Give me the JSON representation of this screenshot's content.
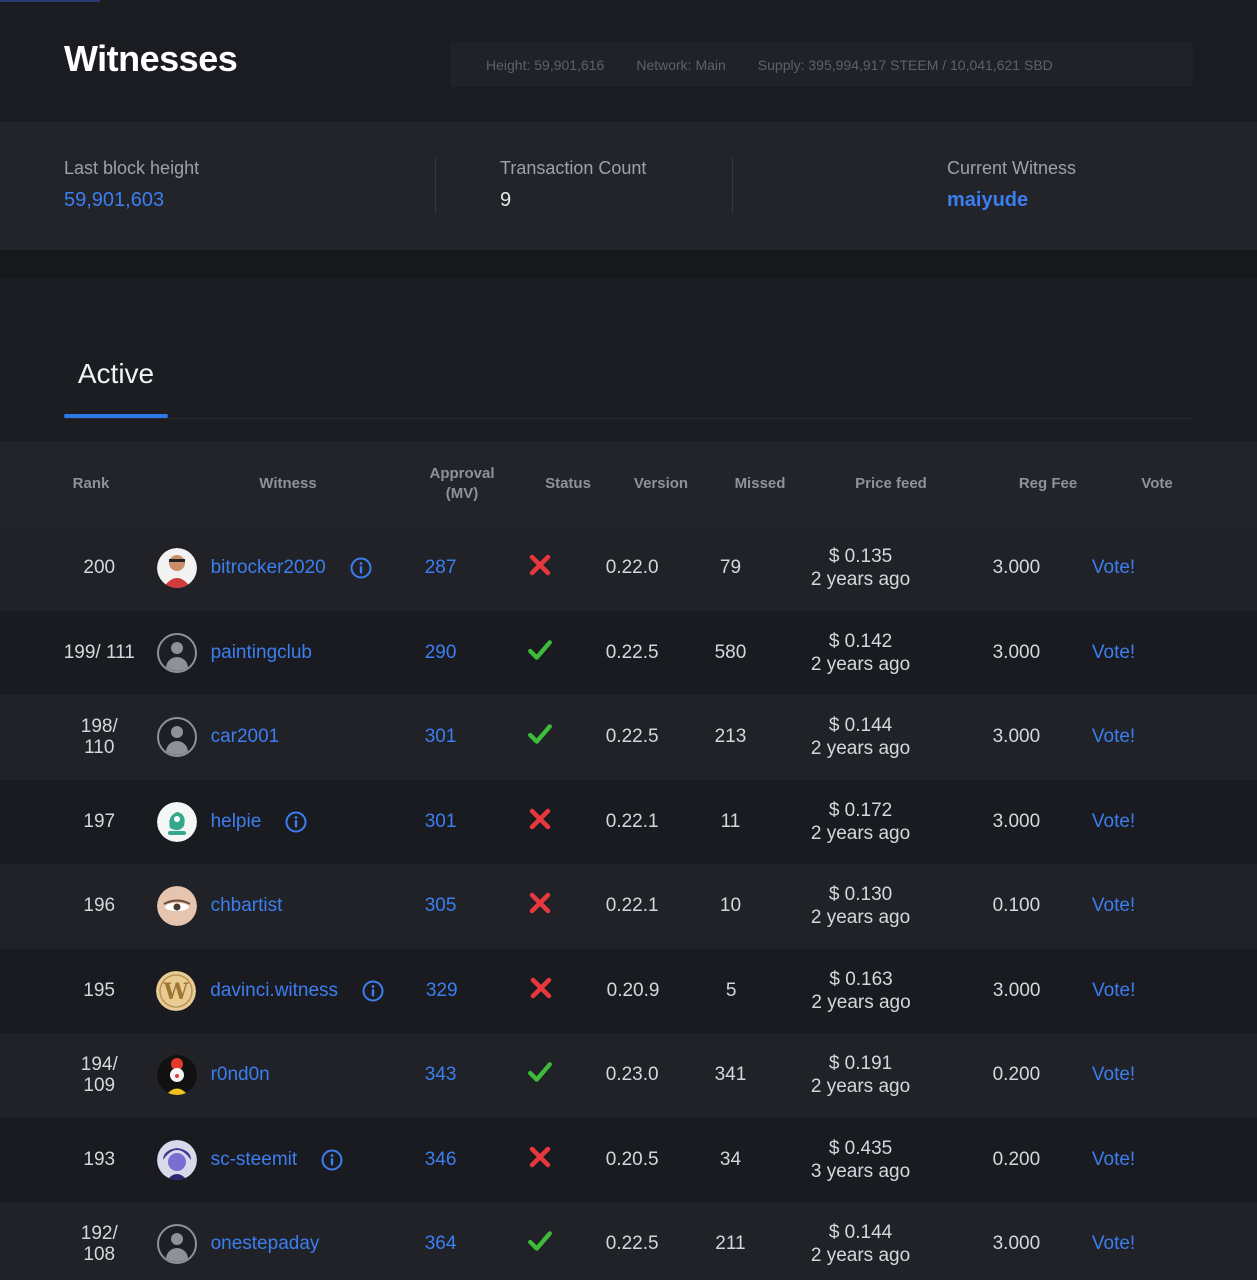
{
  "header": {
    "title": "Witnesses",
    "height": "Height: 59,901,616",
    "network": "Network: Main",
    "supply": "Supply: 395,994,917 STEEM / 10,041,621 SBD"
  },
  "stats": {
    "last_block_label": "Last block height",
    "last_block_value": "59,901,603",
    "tx_count_label": "Transaction Count",
    "tx_count_value": "9",
    "current_witness_label": "Current Witness",
    "current_witness_value": "maiyude"
  },
  "tabs": {
    "active_label": "Active"
  },
  "table": {
    "headers": {
      "rank": "Rank",
      "witness": "Witness",
      "approval_line1": "Approval",
      "approval_line2": "(MV)",
      "status": "Status",
      "version": "Version",
      "missed": "Missed",
      "price_feed": "Price feed",
      "reg_fee": "Reg Fee",
      "vote": "Vote"
    },
    "rows": [
      {
        "rank1": "200",
        "rank2": "",
        "name": "bitrocker2020",
        "avatar": "photo-red",
        "info": true,
        "approval": "287",
        "status": "inactive",
        "version": "0.22.0",
        "missed": "79",
        "price": "$ 0.135",
        "age": "2 years ago",
        "fee": "3.000",
        "vote": "Vote!"
      },
      {
        "rank1": "199/ 111",
        "rank2": "",
        "name": "paintingclub",
        "avatar": "placeholder",
        "info": false,
        "approval": "290",
        "status": "active",
        "version": "0.22.5",
        "missed": "580",
        "price": "$ 0.142",
        "age": "2 years ago",
        "fee": "3.000",
        "vote": "Vote!"
      },
      {
        "rank1": "198/",
        "rank2": "110",
        "name": "car2001",
        "avatar": "placeholder",
        "info": false,
        "approval": "301",
        "status": "active",
        "version": "0.22.5",
        "missed": "213",
        "price": "$ 0.144",
        "age": "2 years ago",
        "fee": "3.000",
        "vote": "Vote!"
      },
      {
        "rank1": "197",
        "rank2": "",
        "name": "helpie",
        "avatar": "photo-teal",
        "info": true,
        "approval": "301",
        "status": "inactive",
        "version": "0.22.1",
        "missed": "11",
        "price": "$ 0.172",
        "age": "2 years ago",
        "fee": "3.000",
        "vote": "Vote!"
      },
      {
        "rank1": "196",
        "rank2": "",
        "name": "chbartist",
        "avatar": "photo-skin",
        "info": false,
        "approval": "305",
        "status": "inactive",
        "version": "0.22.1",
        "missed": "10",
        "price": "$ 0.130",
        "age": "2 years ago",
        "fee": "0.100",
        "vote": "Vote!"
      },
      {
        "rank1": "195",
        "rank2": "",
        "name": "davinci.witness",
        "avatar": "photo-gold",
        "info": true,
        "approval": "329",
        "status": "inactive",
        "version": "0.20.9",
        "missed": "5",
        "price": "$ 0.163",
        "age": "2 years ago",
        "fee": "3.000",
        "vote": "Vote!"
      },
      {
        "rank1": "194/",
        "rank2": "109",
        "name": "r0nd0n",
        "avatar": "photo-clown",
        "info": false,
        "approval": "343",
        "status": "active",
        "version": "0.23.0",
        "missed": "341",
        "price": "$ 0.191",
        "age": "2 years ago",
        "fee": "0.200",
        "vote": "Vote!"
      },
      {
        "rank1": "193",
        "rank2": "",
        "name": "sc-steemit",
        "avatar": "photo-purple",
        "info": true,
        "approval": "346",
        "status": "inactive",
        "version": "0.20.5",
        "missed": "34",
        "price": "$ 0.435",
        "age": "3 years ago",
        "fee": "0.200",
        "vote": "Vote!"
      },
      {
        "rank1": "192/",
        "rank2": "108",
        "name": "onestepaday",
        "avatar": "placeholder",
        "info": false,
        "approval": "364",
        "status": "active",
        "version": "0.22.5",
        "missed": "211",
        "price": "$ 0.144",
        "age": "2 years ago",
        "fee": "3.000",
        "vote": "Vote!"
      }
    ]
  },
  "colors": {
    "accent": "#3c7ef0",
    "status_active": "#3dbb3a",
    "status_inactive": "#e8383d"
  }
}
